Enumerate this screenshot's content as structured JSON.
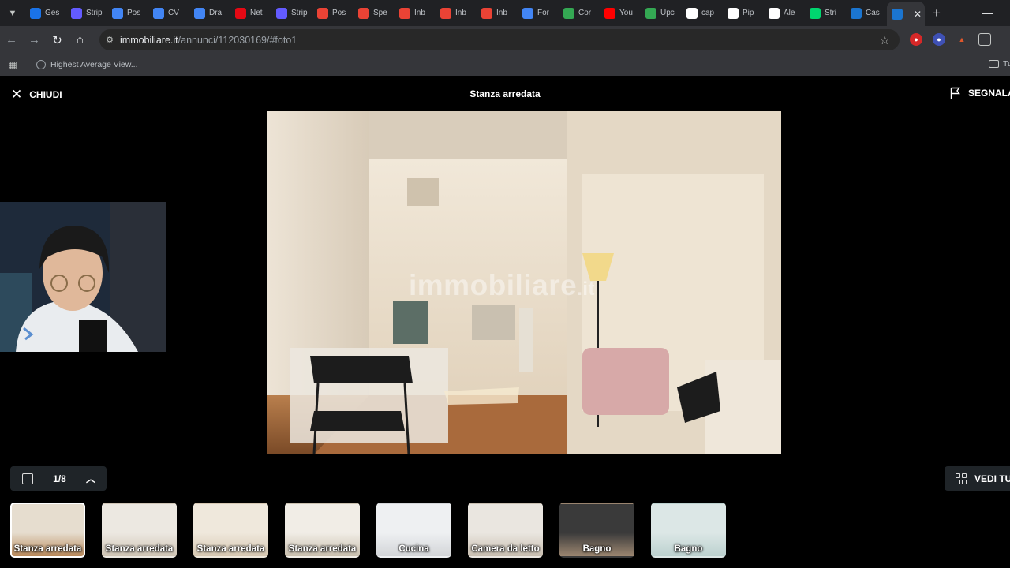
{
  "browser": {
    "tabs": [
      {
        "label": "Ges",
        "icon": "analytics-icon",
        "color": "#1a73e8"
      },
      {
        "label": "Strip",
        "icon": "stripe-icon",
        "color": "#635bff"
      },
      {
        "label": "Pos",
        "icon": "house-icon",
        "color": "#4285f4"
      },
      {
        "label": "CV",
        "icon": "docs-icon",
        "color": "#4285f4"
      },
      {
        "label": "Dra",
        "icon": "docs-icon",
        "color": "#4285f4"
      },
      {
        "label": "Net",
        "icon": "netflix-icon",
        "color": "#e50914"
      },
      {
        "label": "Strip",
        "icon": "stripe-icon",
        "color": "#635bff"
      },
      {
        "label": "Pos",
        "icon": "gmail-icon",
        "color": "#ea4335"
      },
      {
        "label": "Spe",
        "icon": "gmail-icon",
        "color": "#ea4335"
      },
      {
        "label": "Inb",
        "icon": "gmail-icon",
        "color": "#ea4335"
      },
      {
        "label": "Inb",
        "icon": "gmail-icon",
        "color": "#ea4335"
      },
      {
        "label": "Inb",
        "icon": "gmail-icon",
        "color": "#ea4335"
      },
      {
        "label": "For",
        "icon": "google-icon",
        "color": "#4285f4"
      },
      {
        "label": "Cor",
        "icon": "google-icon",
        "color": "#34a853"
      },
      {
        "label": "You",
        "icon": "youtube-icon",
        "color": "#ff0000"
      },
      {
        "label": "Upc",
        "icon": "sheets-plus-icon",
        "color": "#34a853"
      },
      {
        "label": "cap",
        "icon": "capcut-icon",
        "color": "#ffffff"
      },
      {
        "label": "Pip",
        "icon": "pipedrive-icon",
        "color": "#ffffff"
      },
      {
        "label": "Ale",
        "icon": "diamond-icon",
        "color": "#ffffff"
      },
      {
        "label": "Stri",
        "icon": "k-icon",
        "color": "#00d66f"
      },
      {
        "label": "Cas",
        "icon": "immobiliare-icon",
        "color": "#1b75d0"
      },
      {
        "label": "",
        "icon": "immobiliare-icon",
        "color": "#1b75d0",
        "active": true
      }
    ],
    "url_host": "immobiliare.it",
    "url_path": "/annunci/112030169/#foto1",
    "bookmark": "Highest Average View...",
    "bookmark_folder": "Tu"
  },
  "gallery": {
    "close_label": "CHIUDI",
    "title": "Stanza arredata",
    "report_label": "SEGNALA",
    "watermark": "immobiliare",
    "watermark_suffix": ".it",
    "counter": "1/8",
    "see_all_label": "VEDI TU",
    "thumbnails": [
      {
        "label": "Stanza arredata",
        "selected": true
      },
      {
        "label": "Stanza arredata"
      },
      {
        "label": "Stanza arredata"
      },
      {
        "label": "Stanza arredata"
      },
      {
        "label": "Cucina"
      },
      {
        "label": "Camera da letto"
      },
      {
        "label": "Bagno"
      },
      {
        "label": "Bagno"
      }
    ]
  }
}
